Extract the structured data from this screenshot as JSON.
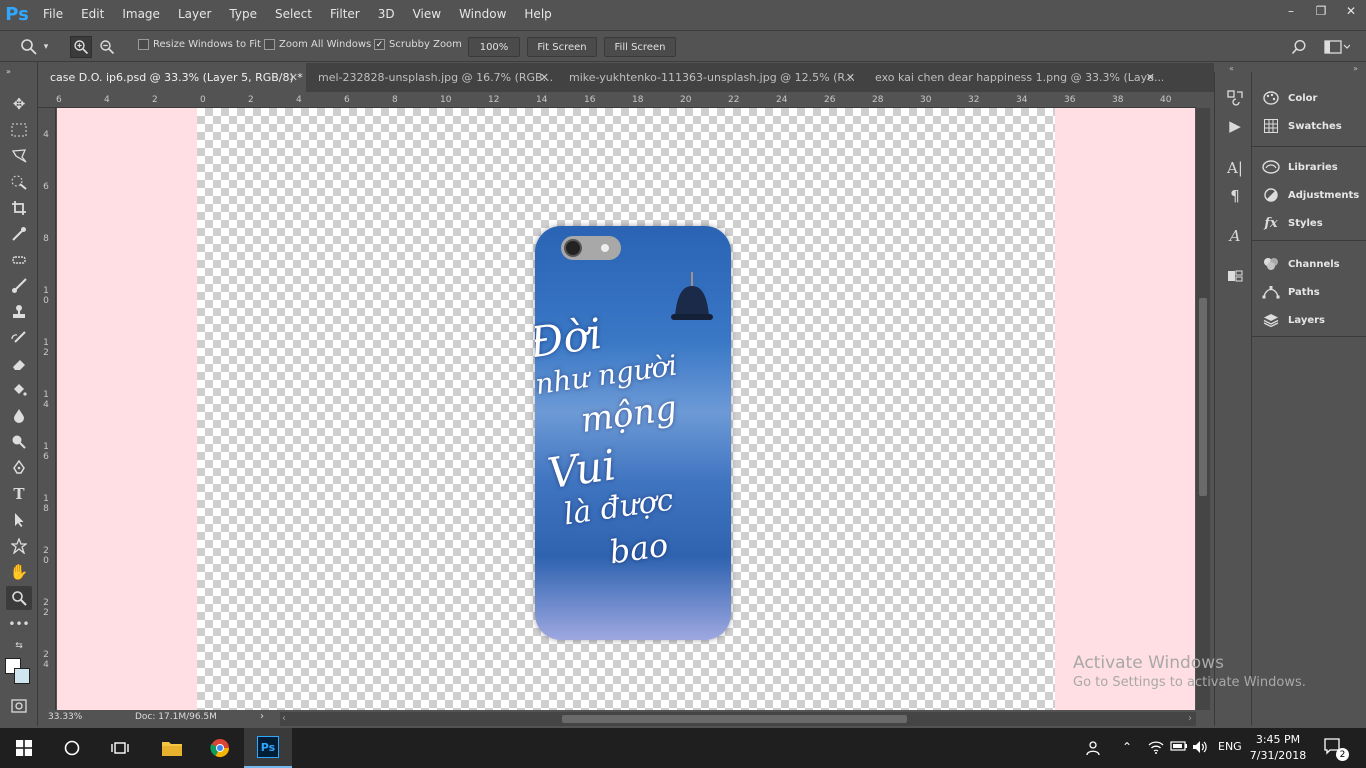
{
  "app": {
    "logo": "Ps"
  },
  "menu": [
    "File",
    "Edit",
    "Image",
    "Layer",
    "Type",
    "Select",
    "Filter",
    "3D",
    "View",
    "Window",
    "Help"
  ],
  "window_controls": [
    "–",
    "❐",
    "✕"
  ],
  "options": {
    "resize_windows": "Resize Windows to Fit",
    "zoom_all": "Zoom All Windows",
    "scrubby_zoom": "Scrubby Zoom",
    "zoom_value": "100%",
    "fit_screen": "Fit Screen",
    "fill_screen": "Fill Screen"
  },
  "tabs": [
    {
      "label": "case D.O. ip6.psd @ 33.3% (Layer 5, RGB/8) *",
      "active": true
    },
    {
      "label": "mel-232828-unsplash.jpg @ 16.7% (RGB...",
      "active": false
    },
    {
      "label": "mike-yukhtenko-111363-unsplash.jpg @ 12.5% (R...",
      "active": false
    },
    {
      "label": "exo kai chen dear happiness 1.png @ 33.3% (Laye...",
      "active": false
    }
  ],
  "ruler_h": [
    "6",
    "4",
    "2",
    "0",
    "2",
    "4",
    "6",
    "8",
    "10",
    "12",
    "14",
    "16",
    "18",
    "20",
    "22",
    "24",
    "26",
    "28",
    "30",
    "32",
    "34",
    "36",
    "38",
    "40"
  ],
  "ruler_v": [
    "4",
    "6",
    "8",
    "1\n0",
    "1\n2",
    "1\n4",
    "1\n6",
    "1\n8",
    "2\n0",
    "2\n2",
    "2\n4"
  ],
  "artwork_text": [
    "Đời",
    "như người",
    "mộng",
    "Vui",
    "là được",
    "bao"
  ],
  "status": {
    "zoom": "33.33%",
    "doc": "Doc: 17.1M/96.5M"
  },
  "panels": {
    "color": "Color",
    "swatches": "Swatches",
    "libraries": "Libraries",
    "adjustments": "Adjustments",
    "styles": "Styles",
    "channels": "Channels",
    "paths": "Paths",
    "layers": "Layers"
  },
  "activate": {
    "title": "Activate Windows",
    "sub": "Go to Settings to activate Windows."
  },
  "taskbar": {
    "lang": "ENG",
    "time": "3:45 PM",
    "date": "7/31/2018",
    "notifications": "2"
  },
  "colors": {
    "canvas_bg": "#ffdfe3",
    "ps_blue": "#31a8ff",
    "ui_gray": "#535353"
  }
}
